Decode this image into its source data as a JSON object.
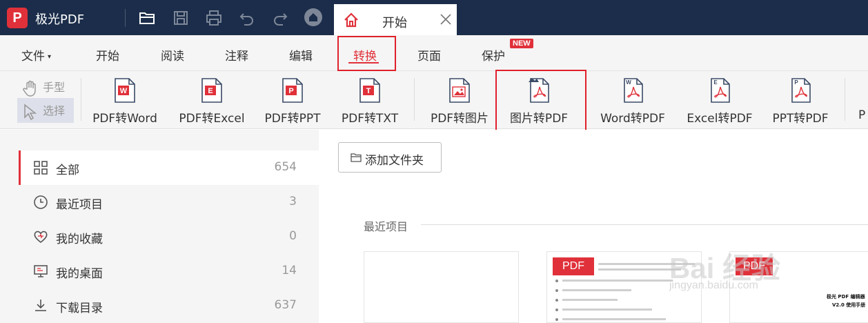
{
  "titlebar": {
    "logo_letter": "P",
    "app_name": "极光PDF",
    "active_tab": "开始",
    "icons": [
      "folder-open-icon",
      "save-icon",
      "print-icon",
      "undo-icon",
      "redo-icon",
      "home-icon",
      "close-icon"
    ]
  },
  "menu": {
    "items": [
      {
        "label": "文件"
      },
      {
        "label": "开始"
      },
      {
        "label": "阅读"
      },
      {
        "label": "注释"
      },
      {
        "label": "编辑"
      },
      {
        "label": "转换"
      },
      {
        "label": "页面"
      },
      {
        "label": "保护"
      }
    ],
    "active": "转换",
    "new_badge": "NEW"
  },
  "ribbon": {
    "hand_tool": "手型",
    "select_tool": "选择",
    "buttons": [
      {
        "label": "PDF转Word",
        "icon": "W"
      },
      {
        "label": "PDF转Excel",
        "icon": "E"
      },
      {
        "label": "PDF转PPT",
        "icon": "P"
      },
      {
        "label": "PDF转TXT",
        "icon": "T"
      },
      {
        "label": "PDF转图片",
        "icon": "image"
      },
      {
        "label": "图片转PDF",
        "icon": "image-pdf"
      },
      {
        "label": "Word转PDF",
        "icon": "W"
      },
      {
        "label": "Excel转PDF",
        "icon": "E"
      },
      {
        "label": "PPT转PDF",
        "icon": "P"
      }
    ],
    "partial_label": "P",
    "colors": {
      "accent": "#e0313a",
      "highlight_box": "#e0202a"
    }
  },
  "sidebar": {
    "items": [
      {
        "label": "全部",
        "count": "654",
        "icon": "grid-icon"
      },
      {
        "label": "最近项目",
        "count": "3",
        "icon": "clock-icon"
      },
      {
        "label": "我的收藏",
        "count": "0",
        "icon": "heart-icon"
      },
      {
        "label": "我的桌面",
        "count": "14",
        "icon": "monitor-icon"
      },
      {
        "label": "下载目录",
        "count": "637",
        "icon": "download-icon"
      }
    ]
  },
  "main": {
    "add_folder": "添加文件夹",
    "recent_title": "最近项目",
    "card_badge": "PDF",
    "card3_title": "极光 PDF 编辑器",
    "card3_sub": "V2.0 使用手册"
  },
  "watermark": {
    "text": "Bai 经验",
    "url": "jingyan.baidu.com"
  }
}
